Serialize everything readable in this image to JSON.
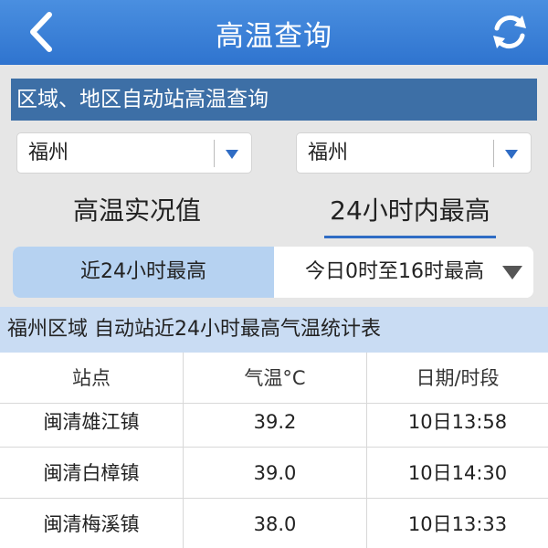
{
  "header": {
    "title": "高温查询",
    "back_icon": "chevron-left-icon",
    "refresh_icon": "refresh-icon",
    "background": "#3a80d8"
  },
  "section": {
    "label": "区域、地区自动站高温查询"
  },
  "selects": [
    {
      "value": "福州"
    },
    {
      "value": "福州"
    }
  ],
  "tabs": [
    {
      "label": "高温实况值",
      "active": false
    },
    {
      "label": "24小时内最高",
      "active": true
    }
  ],
  "segment": {
    "left_label": "近24小时最高",
    "right_label": "今日0时至16时最高",
    "active": "left"
  },
  "table": {
    "title": "福州区域 自动站近24小时最高气温统计表",
    "columns": [
      "站点",
      "气温°C",
      "日期/时段"
    ],
    "rows": [
      [
        "闽清雄江镇",
        "39.2",
        "10日13:58"
      ],
      [
        "闽清白樟镇",
        "39.0",
        "10日14:30"
      ],
      [
        "闽清梅溪镇",
        "38.0",
        "10日13:33"
      ]
    ]
  },
  "colors": {
    "accent": "#2f6cc4",
    "section_bar": "#3d6fa6",
    "segment_active": "#b6d2f1",
    "table_title_bg": "#c9dcf3"
  }
}
